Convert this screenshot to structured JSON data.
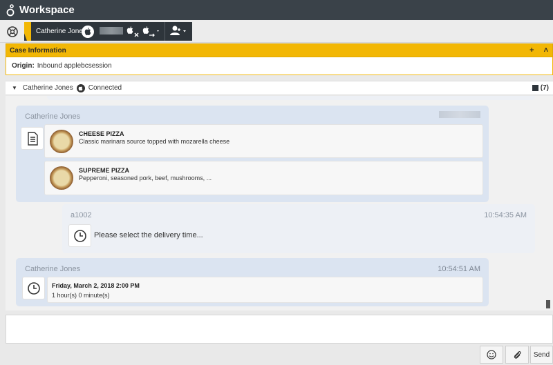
{
  "app": {
    "title": "Workspace"
  },
  "toolbar": {
    "contact_name": "Catherine Jones"
  },
  "case": {
    "header": "Case Information",
    "origin_label": "Origin:",
    "origin_value": "Inbound applebcsession"
  },
  "connection": {
    "name": "Catherine Jones",
    "status": "Connected",
    "history_count": "(7)"
  },
  "transcript": {
    "messages": [
      {
        "sender": "Catherine Jones",
        "items": [
          {
            "title": "CHEESE PIZZA",
            "description": "Classic marinara source topped with mozarella cheese"
          },
          {
            "title": "SUPREME PIZZA",
            "description": "Pepperoni, seasoned pork, beef, mushrooms, ..."
          }
        ]
      },
      {
        "sender": "a1002",
        "time": "10:54:35 AM",
        "text": "Please select the delivery time..."
      },
      {
        "sender": "Catherine Jones",
        "time": "10:54:51 AM",
        "selection_title": "Friday, March 2, 2018 2:00 PM",
        "selection_detail": "1 hour(s) 0 minute(s)"
      }
    ]
  },
  "actions": {
    "send_label": "Send"
  },
  "icons": [
    "workspace-logo-icon",
    "globe-icon",
    "apple-icon",
    "apple-end-icon",
    "apple-transfer-icon",
    "contact-icon",
    "list-icon",
    "clock-icon",
    "history-icon",
    "emoji-icon",
    "paperclip-icon"
  ],
  "colors": {
    "titlebar": "#3a4249",
    "accent": "#f2b705",
    "customer_bubble": "#dbe4f1",
    "agent_bubble": "#edf0f5"
  }
}
